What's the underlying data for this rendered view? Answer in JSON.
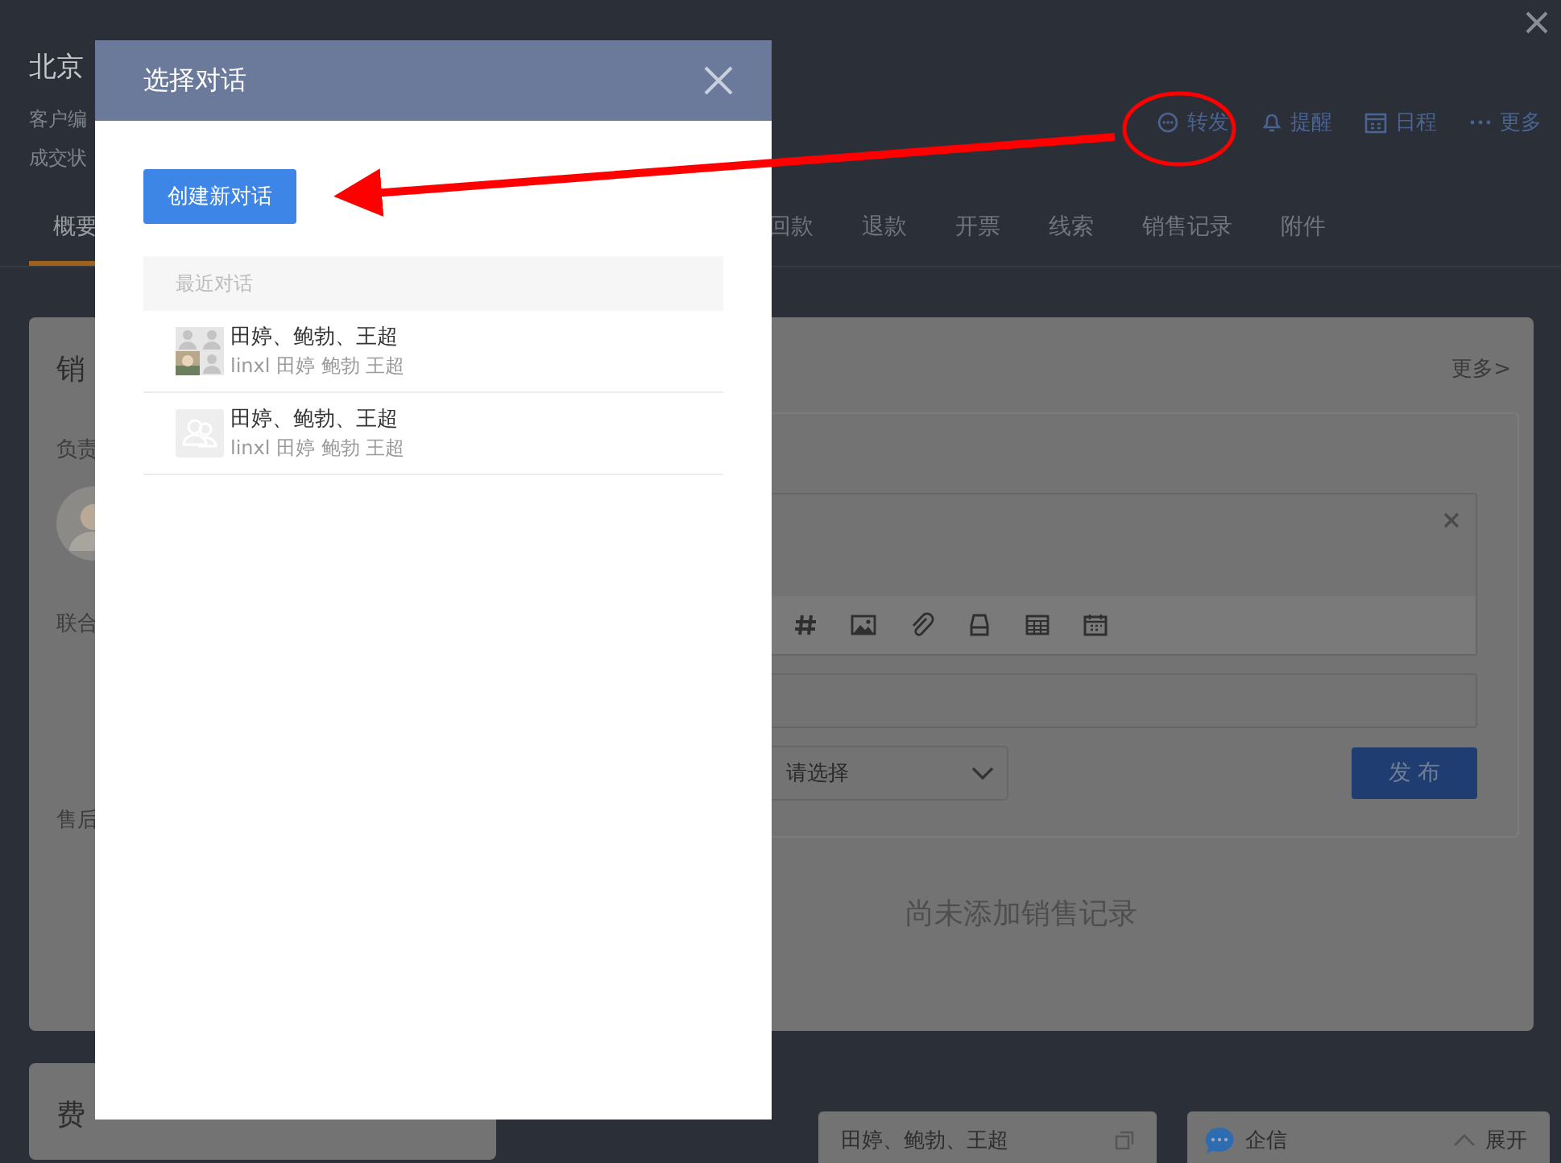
{
  "header": {
    "title": "北京",
    "info_lines": [
      "客户编",
      "成交状"
    ],
    "actions": [
      {
        "kind": "chat",
        "label": "转发"
      },
      {
        "kind": "bell",
        "label": "提醒"
      },
      {
        "kind": "calendar",
        "label": "日程"
      },
      {
        "kind": "dots",
        "label": "更多"
      }
    ]
  },
  "tabs": [
    {
      "label": "概要",
      "selected": true
    },
    {
      "label": "回款",
      "selected": false
    },
    {
      "label": "退款",
      "selected": false
    },
    {
      "label": "开票",
      "selected": false
    },
    {
      "label": "线索",
      "selected": false
    },
    {
      "label": "销售记录",
      "selected": false
    },
    {
      "label": "附件",
      "selected": false
    }
  ],
  "sales_card": {
    "title": "销",
    "more": "更多>",
    "fields": [
      "负责",
      "联合",
      "售后"
    ],
    "select": {
      "value": "请选择"
    },
    "publish_button": "发 布",
    "empty_text": "尚未添加销售记录"
  },
  "expense_card": {
    "title": "费"
  },
  "dock": {
    "chat_tab": "田婷、鲍勃、王超",
    "messenger": {
      "label": "企信",
      "expand": "展开"
    }
  },
  "dialog": {
    "title": "选择对话",
    "create_button": "创建新对话",
    "section": "最近对话",
    "conversations": [
      {
        "title": "田婷、鲍勃、王超",
        "members": "linxl 田婷 鲍勃 王超",
        "kind": "grid"
      },
      {
        "title": "田婷、鲍勃、王超",
        "members": "linxl 田婷 鲍勃 王超",
        "kind": "group"
      }
    ]
  }
}
